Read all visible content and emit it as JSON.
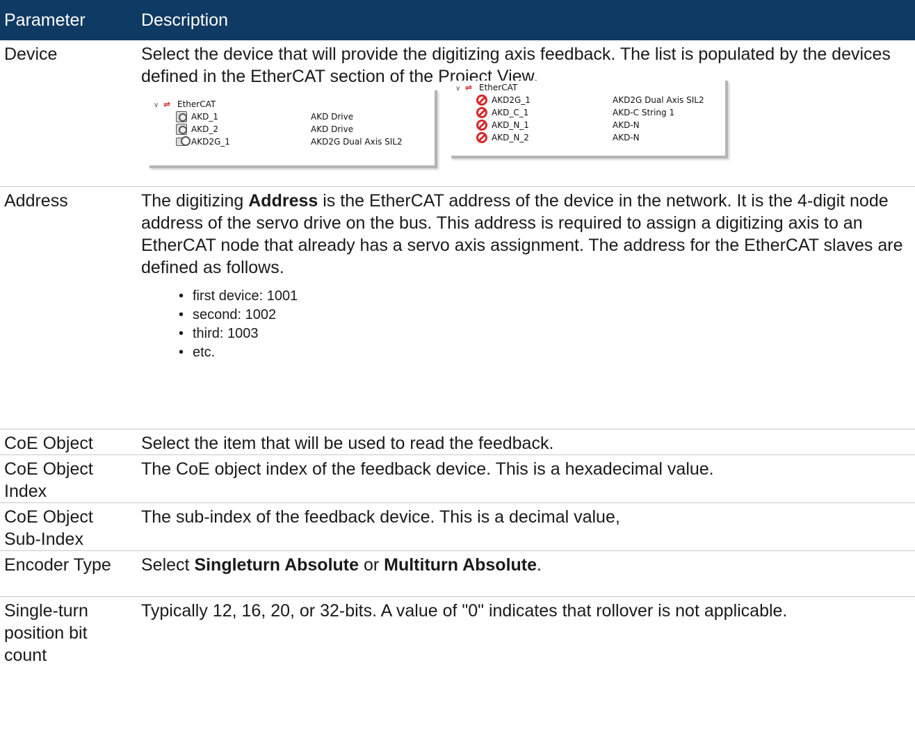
{
  "table": {
    "headers": {
      "parameter": "Parameter",
      "description": "Description"
    },
    "device": {
      "name": "Device",
      "text": "Select the device that will provide the digitizing axis feedback. The list is populated by the devices defined in the EtherCAT section of the Project View."
    },
    "address": {
      "name": "Address",
      "text_before": "The digitizing ",
      "keyword": "Address",
      "text_after": " is the EtherCAT address of the device in the network. It is the 4-digit node address of the servo drive on the bus. This address is required to assign a digitizing axis to an EtherCAT node that already has a servo axis assignment. The address for the EtherCAT slaves are defined as follows.",
      "bullets": [
        "first device: 1001",
        "second: 1002",
        "third: 1003",
        "etc."
      ]
    },
    "coe_object": {
      "name": "CoE Object",
      "text": "Select the item that will be used to read the feedback."
    },
    "coe_index": {
      "name": "CoE Object Index",
      "text": "The CoE object index of the feedback device. This is a hexadecimal value."
    },
    "coe_subindex": {
      "name": "CoE Object Sub-Index",
      "text": "The sub-index of the feedback device. This is a decimal value,"
    },
    "encoder_type": {
      "name": "Encoder Type",
      "text_before": "Select ",
      "option_a": "Singleturn Absolute",
      "text_mid": " or ",
      "option_b": "Multiturn Absolute",
      "text_after": "."
    },
    "single_turn": {
      "name": "Single-turn position bit count",
      "text": "Typically 12, 16, 20, or 32-bits. A value of \"0\" indicates that rollover is not applicable."
    }
  },
  "tree1": {
    "root": "EtherCAT",
    "items": [
      {
        "name": "AKD_1",
        "desc": "AKD Drive",
        "icon": "gear-icon"
      },
      {
        "name": "AKD_2",
        "desc": "AKD Drive",
        "icon": "gear-icon"
      },
      {
        "name": "AKD2G_1",
        "desc": "AKD2G Dual Axis SIL2",
        "icon": "dual-axis-icon"
      }
    ]
  },
  "tree2": {
    "root": "EtherCAT",
    "items": [
      {
        "name": "AKD2G_1",
        "desc": "AKD2G Dual Axis SIL2",
        "icon": "disabled-icon"
      },
      {
        "name": "AKD_C_1",
        "desc": "AKD-C String 1",
        "icon": "disabled-icon"
      },
      {
        "name": "AKD_N_1",
        "desc": "AKD-N",
        "icon": "disabled-icon"
      },
      {
        "name": "AKD_N_2",
        "desc": "AKD-N",
        "icon": "disabled-icon"
      }
    ]
  },
  "colors": {
    "header_bg": "#0f3a63",
    "header_text": "#ffffff",
    "error_red": "#d42a2a"
  }
}
